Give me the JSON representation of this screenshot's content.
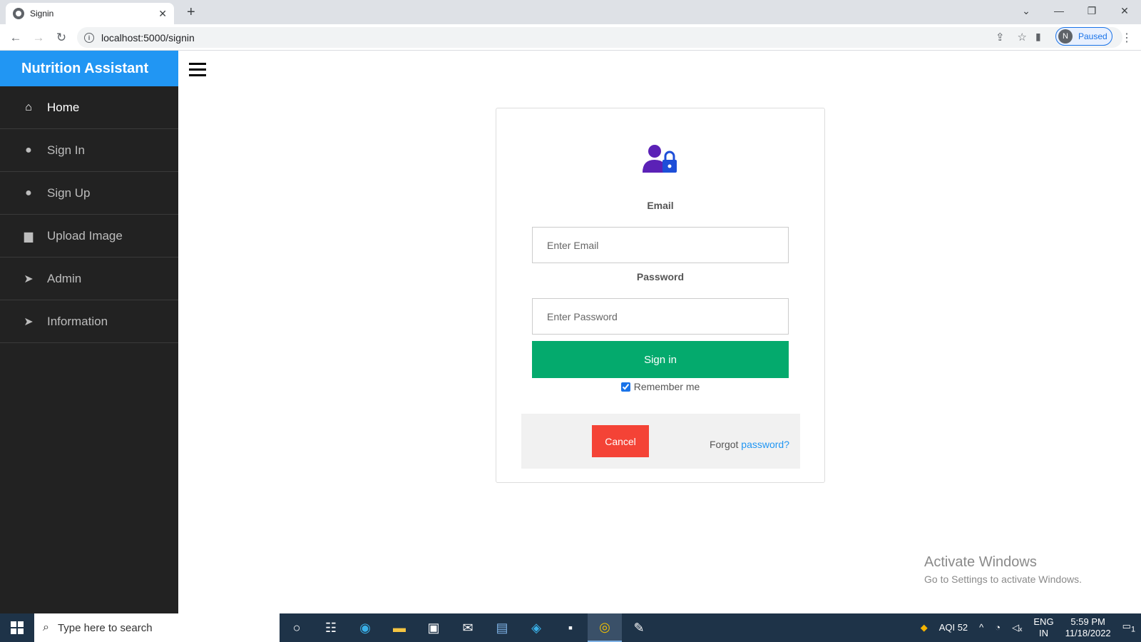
{
  "browser": {
    "tab_title": "Signin",
    "tab_close": "✕",
    "new_tab": "+",
    "url": "localhost:5000/signin",
    "profile_initial": "N",
    "profile_status": "Paused"
  },
  "sidebar": {
    "brand": "Nutrition Assistant",
    "items": [
      {
        "label": "Home",
        "icon": "home-icon",
        "active": true
      },
      {
        "label": "Sign In",
        "icon": "user-icon"
      },
      {
        "label": "Sign Up",
        "icon": "user-icon"
      },
      {
        "label": "Upload Image",
        "icon": "file-icon"
      },
      {
        "label": "Admin",
        "icon": "paper-plane-icon"
      },
      {
        "label": "Information",
        "icon": "paper-plane-icon"
      }
    ]
  },
  "form": {
    "email_label": "Email",
    "email_placeholder": "Enter Email",
    "password_label": "Password",
    "password_placeholder": "Enter Password",
    "signin_label": "Sign in",
    "remember_label": "Remember me",
    "remember_checked": true,
    "cancel_label": "Cancel",
    "forgot_text": "Forgot",
    "forgot_link": "password?"
  },
  "watermark": {
    "line1": "Activate Windows",
    "line2": "Go to Settings to activate Windows."
  },
  "taskbar": {
    "search_placeholder": "Type here to search",
    "aqi": "AQI 52",
    "lang": "ENG",
    "region": "IN",
    "time": "5:59 PM",
    "date": "11/18/2022",
    "notifications": "1"
  },
  "colors": {
    "brand": "#2196f3",
    "sidebar_bg": "#222222",
    "signin_btn": "#04aa6d",
    "cancel_btn": "#f44336"
  }
}
